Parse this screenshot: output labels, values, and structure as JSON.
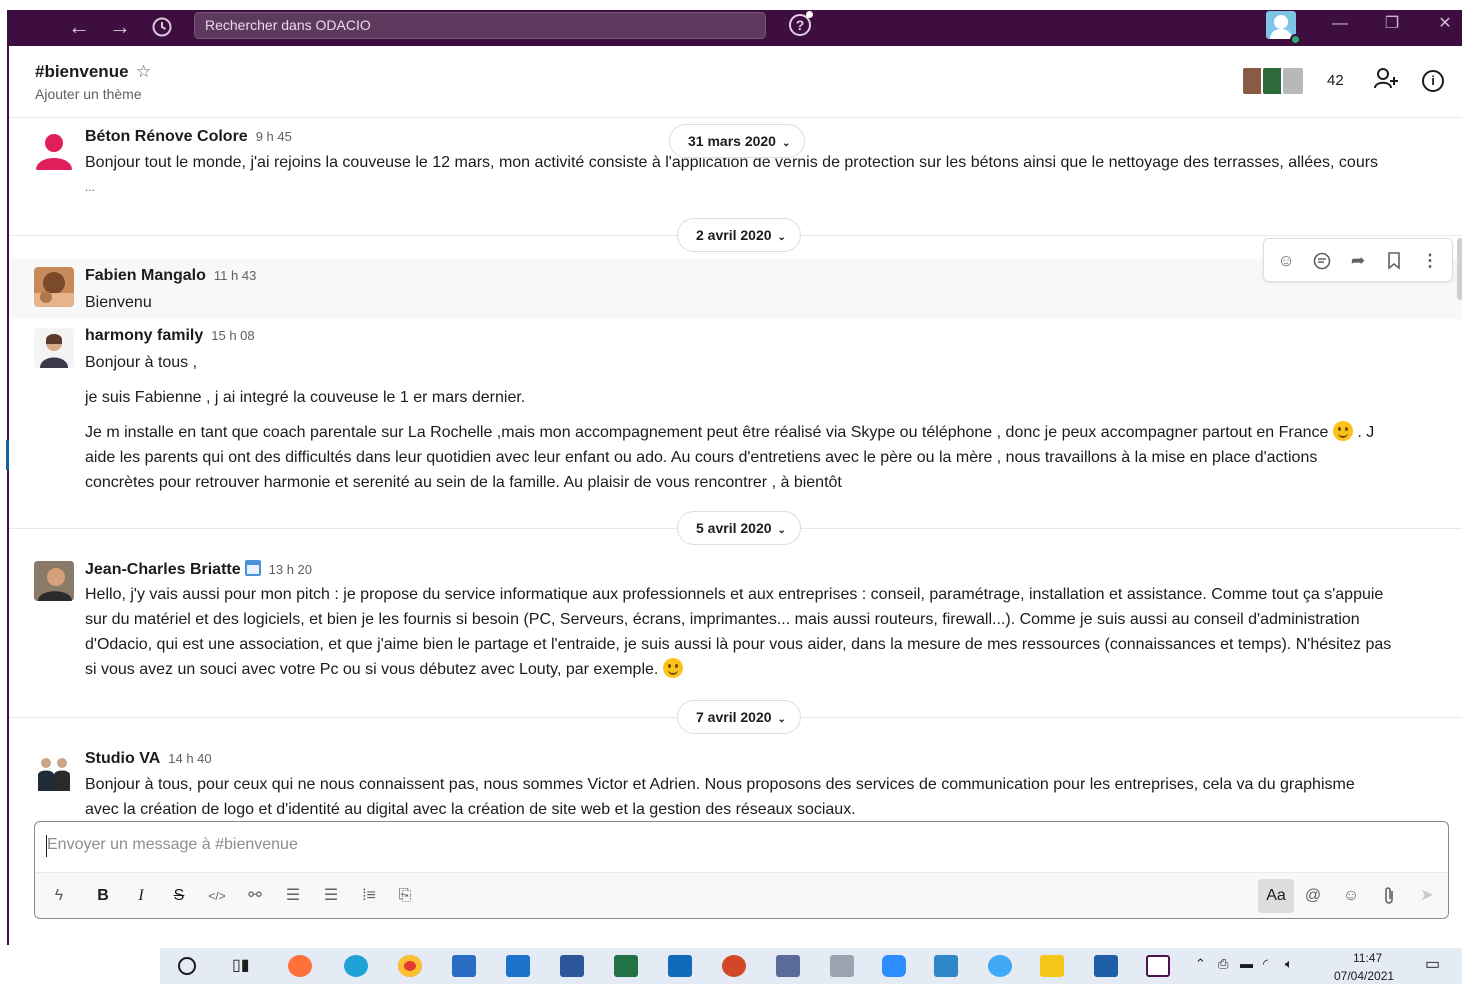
{
  "topbar": {
    "search_placeholder": "Rechercher dans ODACIO",
    "icons": [
      "arrow-left-icon",
      "arrow-right-icon",
      "history-icon",
      "help-icon"
    ],
    "accent_color": "#3f0e40"
  },
  "channel": {
    "name": "#bienvenue",
    "topic": "Ajouter un thème",
    "member_count": "42"
  },
  "messages": [
    {
      "author": "Béton Rénove Colore",
      "time": "9 h 45",
      "lines": [
        "Bonjour tout le monde, j'ai rejoins la couveuse le 12 mars, mon activité consiste à l'application de vernis de protection sur les bétons ainsi que le nettoyage des terrasses, allées, cours",
        "..."
      ]
    },
    {
      "author": "Fabien Mangalo",
      "time": "11 h 43",
      "lines": [
        "Bienvenu"
      ]
    },
    {
      "author": "harmony family",
      "time": "15 h 08",
      "lines": [
        "Bonjour à tous ,",
        "je suis Fabienne , j ai integré la couveuse le 1 er mars dernier.",
        "Je m installe en tant que coach parentale sur La Rochelle ,mais mon accompagnement peut être réalisé via Skype ou téléphone , donc je peux accompagner partout en France",
        ". J",
        "aide les parents qui ont des difficultés dans leur quotidien avec leur enfant ou ado. Au cours d'entretiens avec le père ou la mère , nous travaillons à la mise en place d'actions",
        "concrètes pour retrouver harmonie et serenité au sein de la famille.   Au plaisir de vous rencontrer , à bientôt"
      ]
    },
    {
      "author": "Jean-Charles Briatte",
      "time": "13 h 20",
      "lines": [
        "Hello, j'y vais aussi pour mon pitch : je propose du service informatique aux professionnels et aux entreprises : conseil, paramétrage, installation et assistance. Comme tout ça s'appuie",
        "sur du matériel et des logiciels, et bien je les fournis si besoin (PC, Serveurs, écrans, imprimantes... mais aussi routeurs, firewall...). Comme je suis aussi au conseil d'administration",
        "d'Odacio, qui est une association, et que j'aime bien le partage et l'entraide, je suis aussi là pour vous aider, dans la mesure de mes ressources (connaissances et temps). N'hésitez pas",
        "si vous avez un souci avec votre Pc ou si vous débutez avec Louty, par exemple."
      ]
    },
    {
      "author": "Studio VA",
      "time": "14 h 40",
      "lines": [
        "Bonjour à tous, pour ceux qui ne nous connaissent pas, nous sommes Victor et Adrien. Nous proposons des services de communication pour les entreprises, cela va du graphisme",
        "avec la création de logo et d'identité au digital avec la création de site web et la gestion des réseaux sociaux."
      ]
    }
  ],
  "dates": [
    "31 mars 2020",
    "2 avril 2020",
    "5 avril 2020",
    "7 avril 2020"
  ],
  "composer": {
    "placeholder": "Envoyer un message à #bienvenue",
    "format_label": "Aa"
  },
  "taskbar": {
    "time": "11:47",
    "date": "07/04/2021"
  }
}
